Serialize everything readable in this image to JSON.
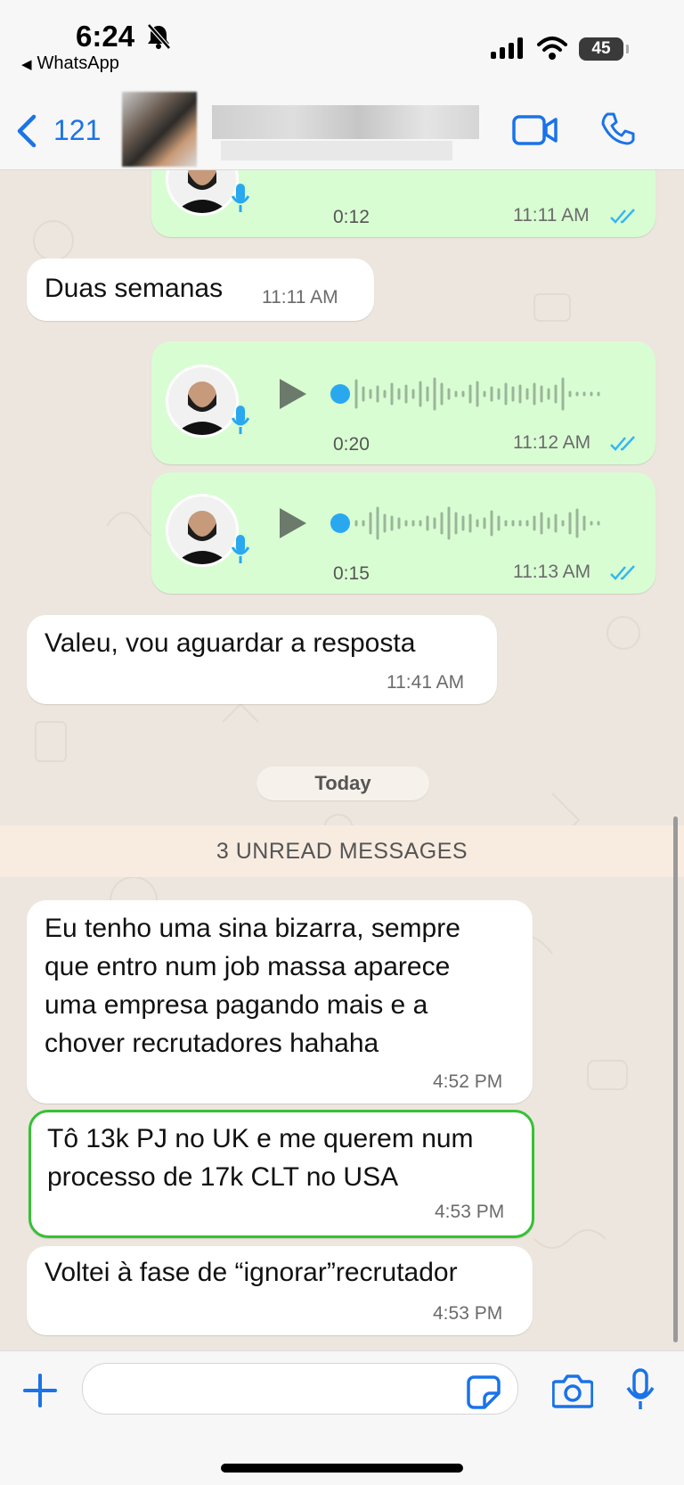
{
  "status_bar": {
    "time": "6:24",
    "back_app": "WhatsApp",
    "battery": "45"
  },
  "header": {
    "back_count": "121"
  },
  "messages": [
    {
      "type": "voice",
      "direction": "out",
      "duration": "0:12",
      "time": "11:11 AM",
      "read": true
    },
    {
      "type": "text",
      "direction": "in",
      "text": "Duas semanas",
      "time": "11:11 AM"
    },
    {
      "type": "voice",
      "direction": "out",
      "duration": "0:20",
      "time": "11:12 AM",
      "read": true
    },
    {
      "type": "voice",
      "direction": "out",
      "duration": "0:15",
      "time": "11:13 AM",
      "read": true
    },
    {
      "type": "text",
      "direction": "in",
      "text": "Valeu, vou aguardar a resposta",
      "time": "11:41 AM"
    },
    {
      "type": "text",
      "direction": "in",
      "lines": [
        "Eu tenho uma sina bizarra, sempre",
        "que entro num job massa aparece",
        "uma empresa pagando mais e a",
        "chover recrutadores hahaha"
      ],
      "time": "4:52 PM"
    },
    {
      "type": "text",
      "direction": "in",
      "lines": [
        "Tô 13k PJ no UK e me querem num",
        "processo de 17k CLT no USA"
      ],
      "time": "4:53 PM",
      "highlighted": true
    },
    {
      "type": "text",
      "direction": "in",
      "text": "Voltei à fase de “ignorar”recrutador",
      "time": "4:53 PM"
    }
  ],
  "date_divider": "Today",
  "unread_banner": "3 UNREAD MESSAGES",
  "colors": {
    "accent": "#1a73e8",
    "outgoing_bubble": "#d9fdd3",
    "incoming_bubble": "#ffffff",
    "read_ticks": "#34b7f1",
    "highlight_border": "#35c135"
  }
}
